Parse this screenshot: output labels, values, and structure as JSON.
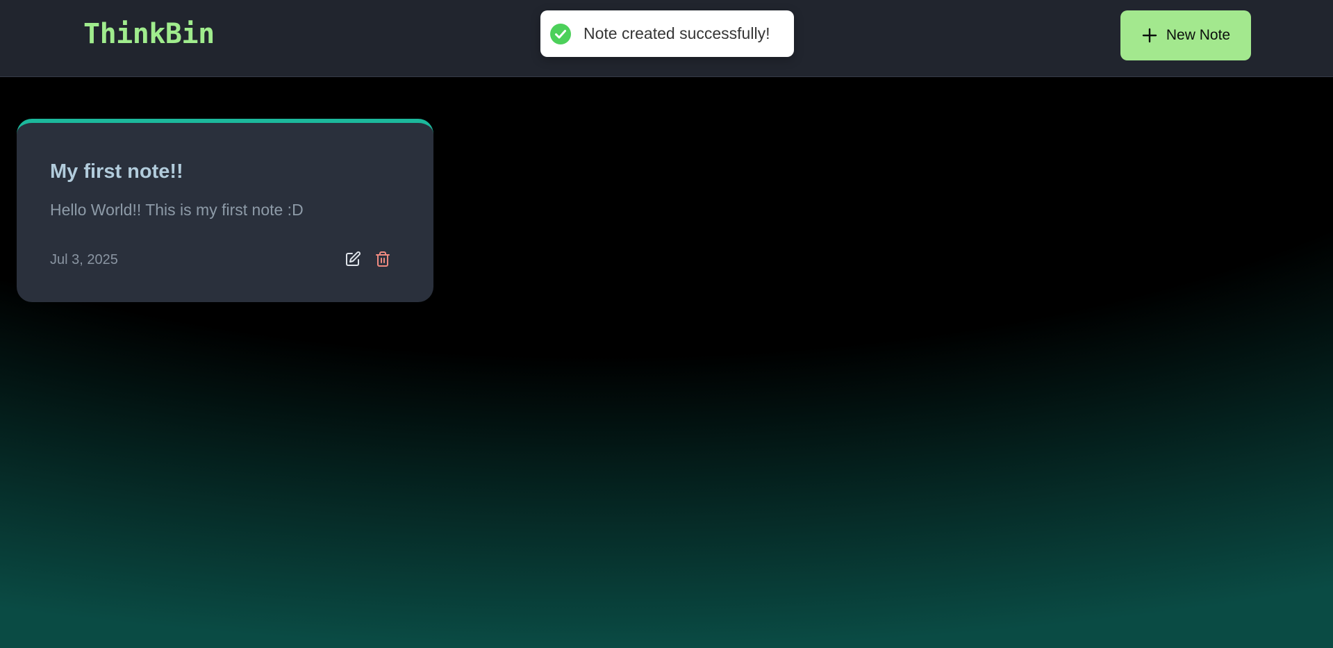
{
  "app": {
    "brand": "ThinkBin"
  },
  "navbar": {
    "new_note_label": "New Note",
    "new_note_icon": "plus-icon"
  },
  "toast": {
    "message": "Note created successfully!",
    "icon": "check-circle-icon",
    "status_color": "#4cd05a"
  },
  "notes": [
    {
      "title": "My first note!!",
      "content": "Hello World!! This is my first note :D",
      "date": "Jul 3, 2025",
      "actions": {
        "edit_icon": "edit-icon",
        "delete_icon": "trash-icon"
      }
    }
  ],
  "colors": {
    "brand": "#a0ec8d",
    "accent": "#a3e88e",
    "card_accent": "#1cb89c",
    "delete": "#f08a80"
  }
}
